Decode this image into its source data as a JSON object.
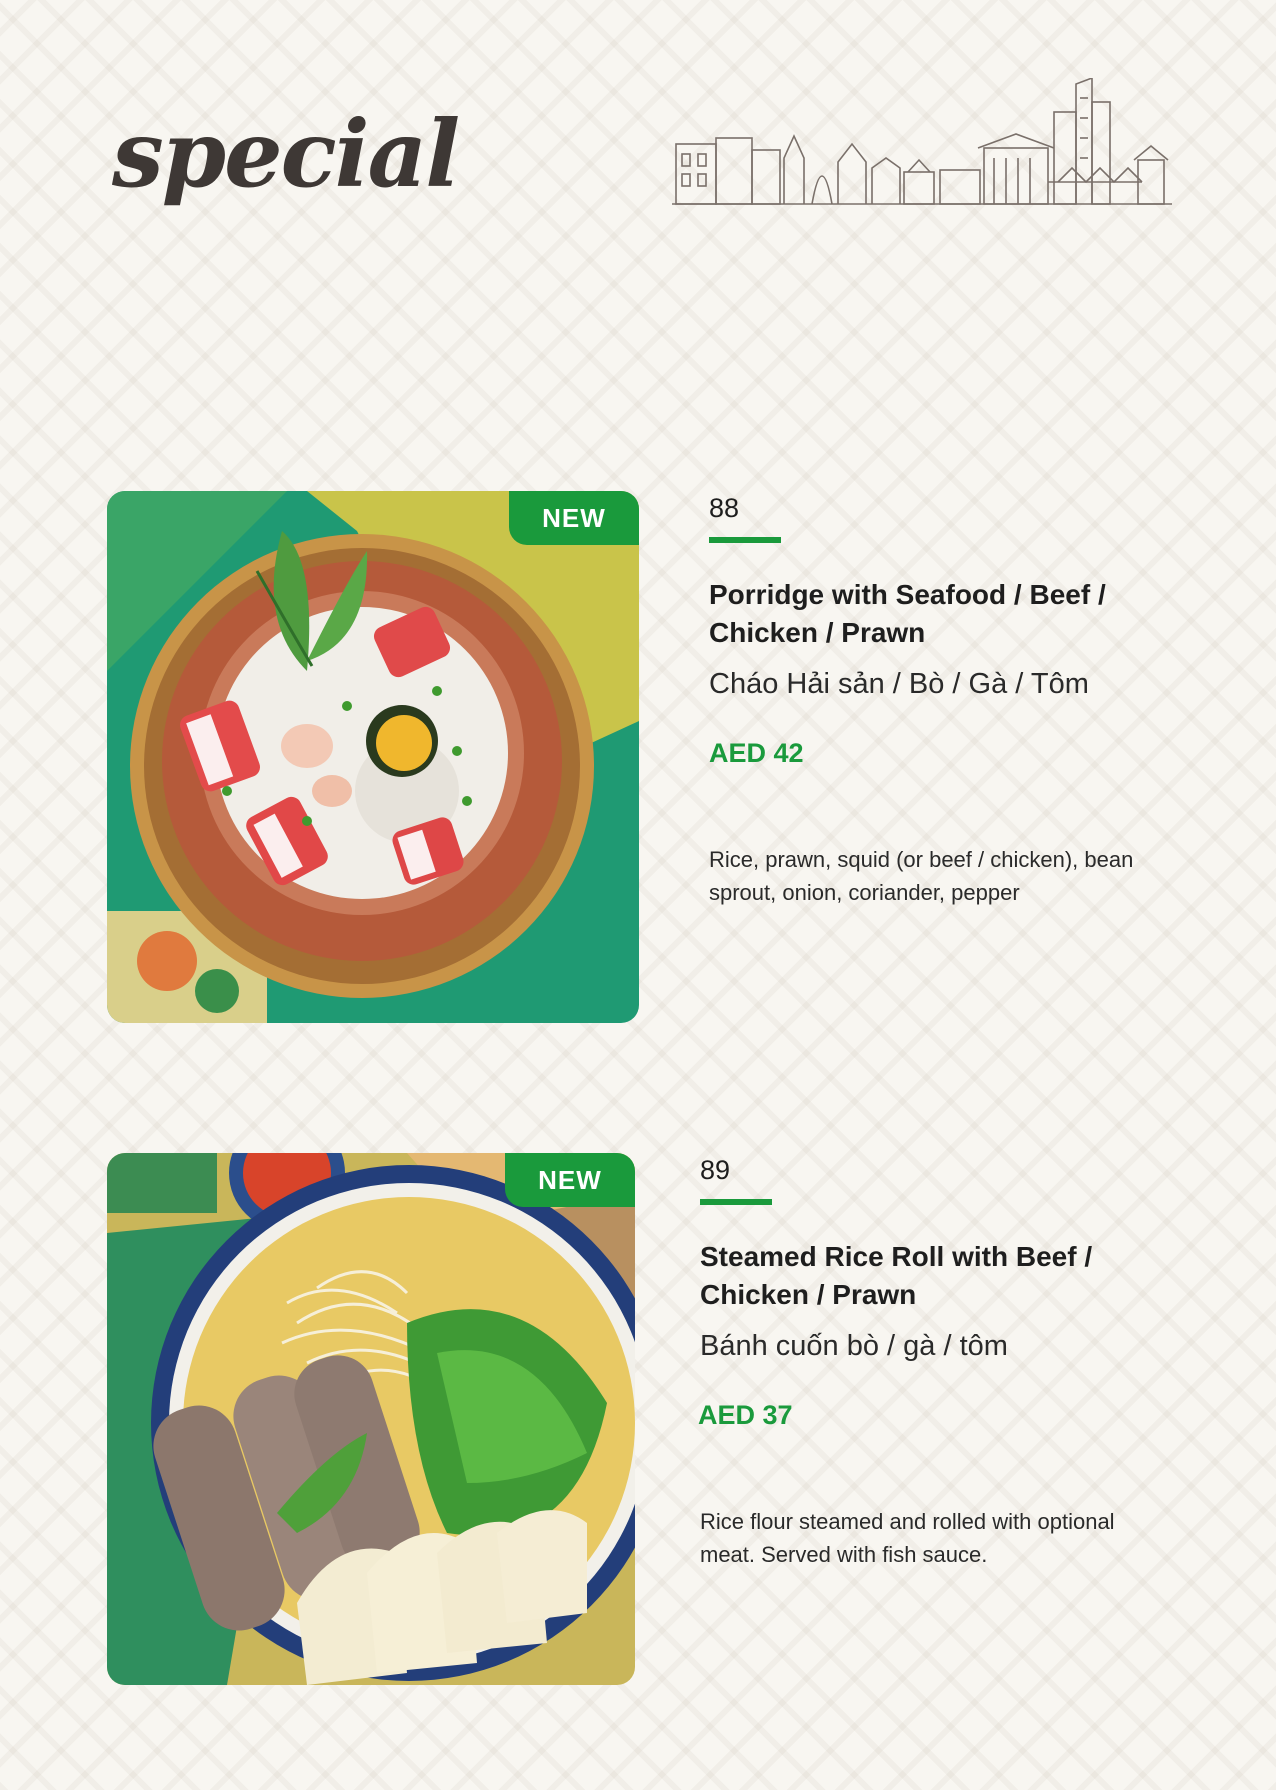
{
  "page": {
    "title": "special"
  },
  "items": [
    {
      "number": "88",
      "badge": "NEW",
      "name": "Porridge with Seafood / Beef / Chicken / Prawn",
      "local_name": "Cháo Hải sản / Bò / Gà / Tôm",
      "price": "AED 42",
      "description": "Rice, prawn, squid (or beef / chicken), bean sprout, onion, coriander, pepper"
    },
    {
      "number": "89",
      "badge": "NEW",
      "name": "Steamed Rice Roll with Beef / Chicken / Prawn",
      "local_name": "Bánh cuốn bò / gà / tôm",
      "price": "AED 37",
      "description": "Rice flour steamed and rolled with optional meat. Served with fish sauce."
    }
  ],
  "colors": {
    "accent": "#1a9a3c",
    "background": "#f8f6f1",
    "title": "#3e3835"
  }
}
